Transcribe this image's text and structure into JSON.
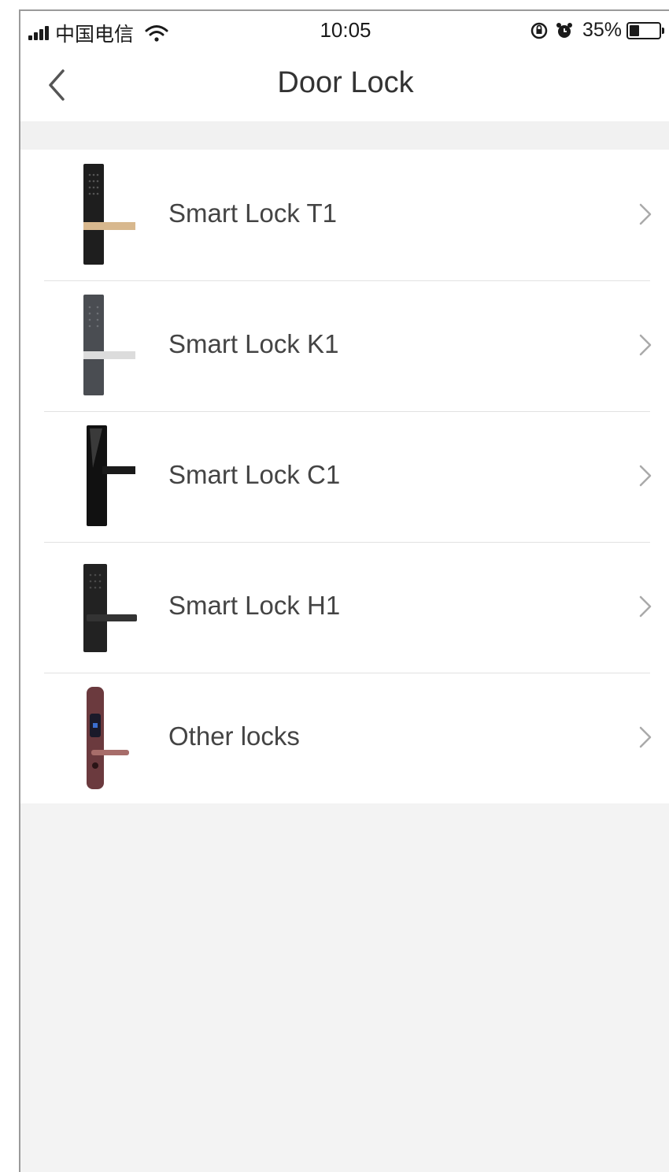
{
  "status_bar": {
    "carrier": "中国电信",
    "time": "10:05",
    "battery": "35%"
  },
  "nav": {
    "title": "Door Lock",
    "back_icon": "chevron-left-icon"
  },
  "locks": [
    {
      "label": "Smart Lock T1",
      "icon": "lock-t1-image",
      "body": "#1e1e1e",
      "handle": "#d8b88e"
    },
    {
      "label": "Smart Lock K1",
      "icon": "lock-k1-image",
      "body": "#4a4d52",
      "handle": "#dcdcdc"
    },
    {
      "label": "Smart Lock C1",
      "icon": "lock-c1-image",
      "body": "#111111",
      "handle": "#1a1a1a"
    },
    {
      "label": "Smart Lock H1",
      "icon": "lock-h1-image",
      "body": "#222222",
      "handle": "#333333"
    },
    {
      "label": "Other locks",
      "icon": "lock-other-image",
      "body": "#6b3a3e",
      "handle": "#a76d6a"
    }
  ],
  "colors": {
    "background": "#f3f3f3",
    "list_background": "#ffffff",
    "divider": "#e2e2e2",
    "text": "#444444"
  }
}
